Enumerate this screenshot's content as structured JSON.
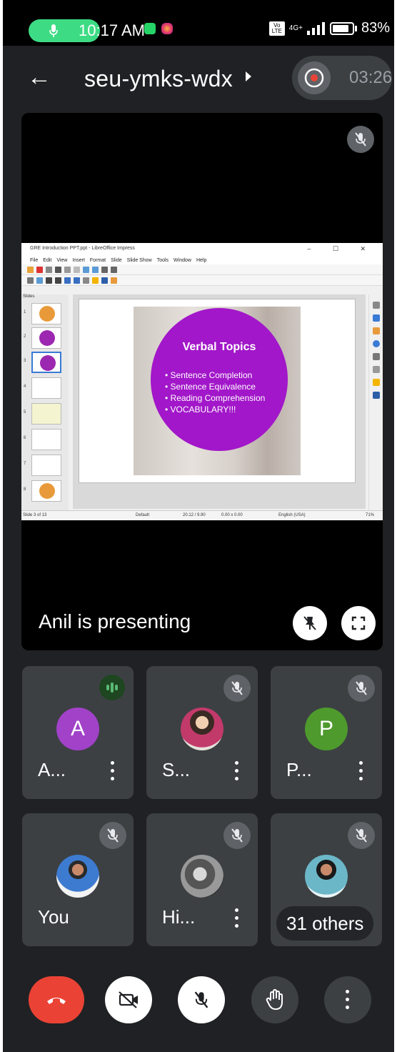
{
  "status_bar": {
    "time": "10:17 AM",
    "network": "4G+",
    "volte": "Vo LTE",
    "battery": "83%"
  },
  "header": {
    "meeting_code": "seu-ymks-wdx",
    "timer": "03:26"
  },
  "presentation": {
    "presenter_label": "Anil is presenting",
    "window_title": "GRE Introduction PPT.ppt - LibreOffice Impress",
    "menu": [
      "File",
      "Edit",
      "View",
      "Insert",
      "Format",
      "Slide",
      "Slide Show",
      "Tools",
      "Window",
      "Help"
    ],
    "panel_label": "Slides",
    "thumb_numbers": [
      "1",
      "2",
      "3",
      "4",
      "5",
      "6",
      "7",
      "8"
    ],
    "slide": {
      "title": "Verbal Topics",
      "bullets": [
        "Sentence Completion",
        "Sentence Equivalence",
        "Reading Comprehension",
        "VOCABULARY!!!"
      ]
    },
    "status": {
      "slide_counter": "Slide 3 of 13",
      "layout": "Default",
      "position": "20.12 / 9.90",
      "size": "0.00 x 0.00",
      "language": "English (USA)",
      "zoom": "71%"
    }
  },
  "participants": [
    {
      "initial": "A",
      "name": "A...",
      "color": "#a142c8",
      "speaking": true
    },
    {
      "initial": "",
      "name": "S...",
      "color": "#8a4a5a",
      "speaking": false
    },
    {
      "initial": "P",
      "name": "P...",
      "color": "#4e9a2d",
      "speaking": false
    },
    {
      "initial": "",
      "name": "You",
      "color": "#f2f2f2",
      "speaking": false
    },
    {
      "initial": "",
      "name": "Hi...",
      "color": "#777777",
      "speaking": false
    },
    {
      "initial": "",
      "name": "",
      "color": "#6bb7c8",
      "speaking": false
    }
  ],
  "others_label": "31 others",
  "colors": {
    "accent_green": "#3ddc84",
    "hangup_red": "#ea4335",
    "tile_bg": "#3c4043",
    "slide_purple": "#a217c9"
  }
}
